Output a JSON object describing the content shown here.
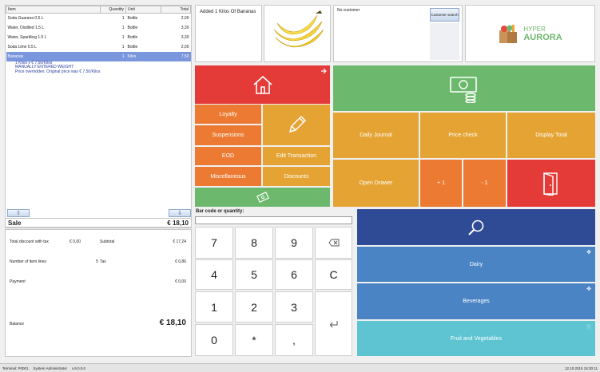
{
  "ticket": {
    "columns": [
      "Item",
      "Quantity",
      "Unit",
      "Total"
    ],
    "rows": [
      {
        "item": "Soda Guarana 0.5 L",
        "qty": "1",
        "unit": "Bottle",
        "total": "2,00"
      },
      {
        "item": "Water, Distilled 1.5 L",
        "qty": "1",
        "unit": "Bottle",
        "total": "3,30"
      },
      {
        "item": "Water, Sparkling 1.5 L",
        "qty": "1",
        "unit": "Bottle",
        "total": "3,30"
      },
      {
        "item": "Soda Lime 0.5 L",
        "qty": "1",
        "unit": "Bottle",
        "total": "2,00"
      },
      {
        "item": "Bananas",
        "qty": "1",
        "unit": "Kilos",
        "total": "7,50"
      }
    ],
    "selected_notes": [
      "1 Kilos x € 7,50/Kilos",
      "MANUALLY ENTERED WEIGHT",
      "Price overridden. Original price was € 7,50/Kilos"
    ],
    "sale_label": "Sale",
    "sale_total": "€ 18,10"
  },
  "summary": {
    "total_discount_label": "Total discount with tax",
    "total_discount_value": "€ 0,00",
    "subtotal_label": "Subtotal",
    "subtotal_value": "€ 17,24",
    "item_lines_label": "Number of item lines",
    "item_lines_value": "5",
    "tax_label": "Tax",
    "tax_value": "€ 0,86",
    "payment_label": "Payment",
    "payment_value": "€ 0,00",
    "balance_label": "Balance",
    "balance_value": "€ 18,10"
  },
  "message": "Added 1 Kilos Of Bananas",
  "customer": {
    "text": "No customer",
    "search_label": "Customer search"
  },
  "logo": {
    "line1": "HYPER",
    "line2": "AURORA"
  },
  "menu": {
    "loyalty": "Loyalty",
    "suspensions": "Suspensions",
    "eod": "EOD",
    "edit_transaction": "Edit Transaction",
    "miscellaneous": "Miscellaneous",
    "discounts": "Discounts"
  },
  "actions": {
    "daily_journal": "Daily Journal",
    "price_check": "Price check",
    "display_total": "Display Total",
    "open_drawer": "Open Drawer",
    "plus_one": "+ 1",
    "minus_one": "- 1"
  },
  "barcode_label": "Bar code or quantity:",
  "keypad": [
    "7",
    "8",
    "9",
    "4",
    "5",
    "6",
    "C",
    "1",
    "2",
    "3",
    "0",
    "*",
    ","
  ],
  "categories": [
    "Dairy",
    "Beverages",
    "Fruit and Vegetables"
  ],
  "status_bar": {
    "terminal": "Terminal: P0001",
    "user": "System Administrator",
    "version": "v.9.0.0.0",
    "datetime": "12.10.2015 15:30:11"
  },
  "colors": {
    "red": "#e43a38",
    "green": "#6cb96d",
    "orange": "#ec7a32",
    "amber": "#e4a333",
    "navy": "#2f4b96",
    "blue": "#4a84c4",
    "teal": "#5ec4d2"
  }
}
